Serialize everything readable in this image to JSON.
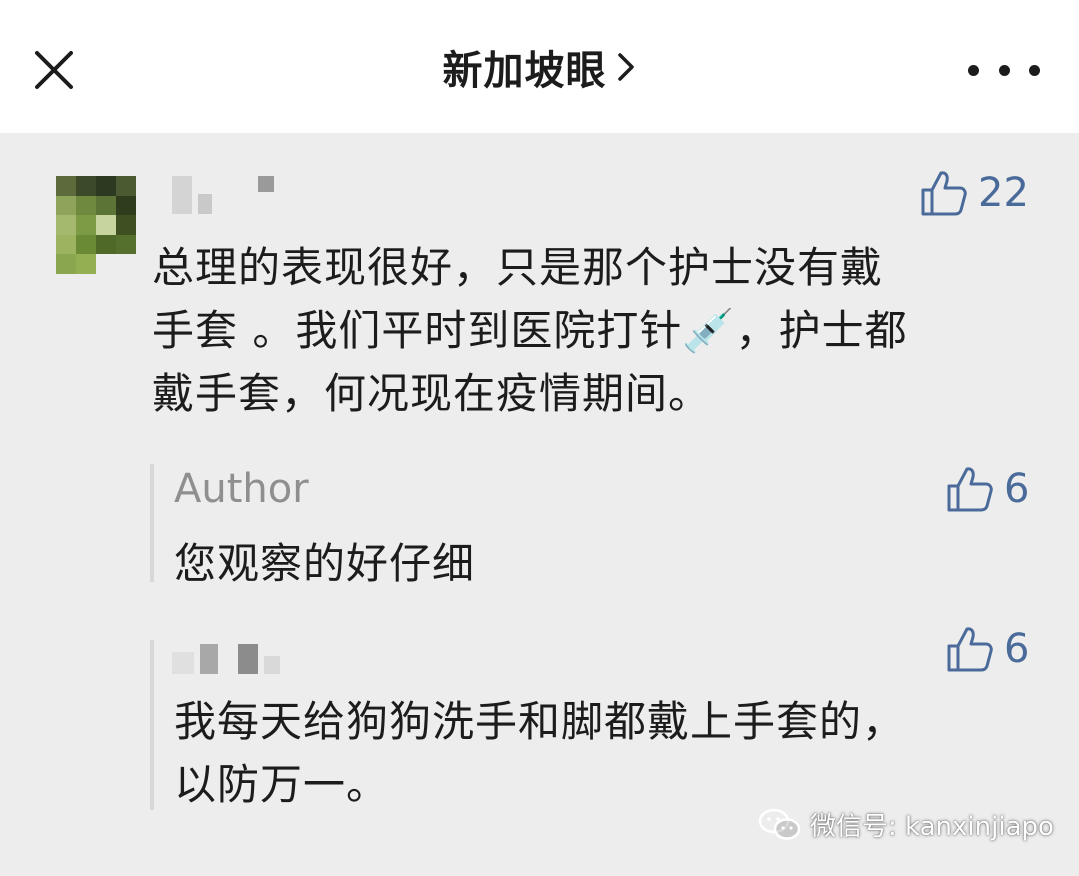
{
  "header": {
    "title": "新加坡眼",
    "close_icon": "close-icon",
    "chevron_icon": "chevron-right-icon",
    "more_icon": "more-dots-icon"
  },
  "comments": [
    {
      "likes": "22",
      "text_lines": [
        "总理的表现很好，只是那个护士没有戴",
        "手套 。我们平时到医院打针💉，护士都",
        "戴手套，何况现在疫情期间。"
      ],
      "replies": [
        {
          "author": "Author",
          "likes": "6",
          "text_lines": [
            "您观察的好仔细"
          ]
        },
        {
          "likes": "6",
          "text_lines": [
            "我每天给狗狗洗手和脚都戴上手套的，",
            "以防万一。"
          ]
        }
      ]
    }
  ],
  "watermark": {
    "text": "微信号: kanxinjiapo",
    "icon": "wechat-icon"
  },
  "colors": {
    "like_blue": "#4a6b9a",
    "background": "#ededed",
    "header_bg": "#ffffff"
  }
}
